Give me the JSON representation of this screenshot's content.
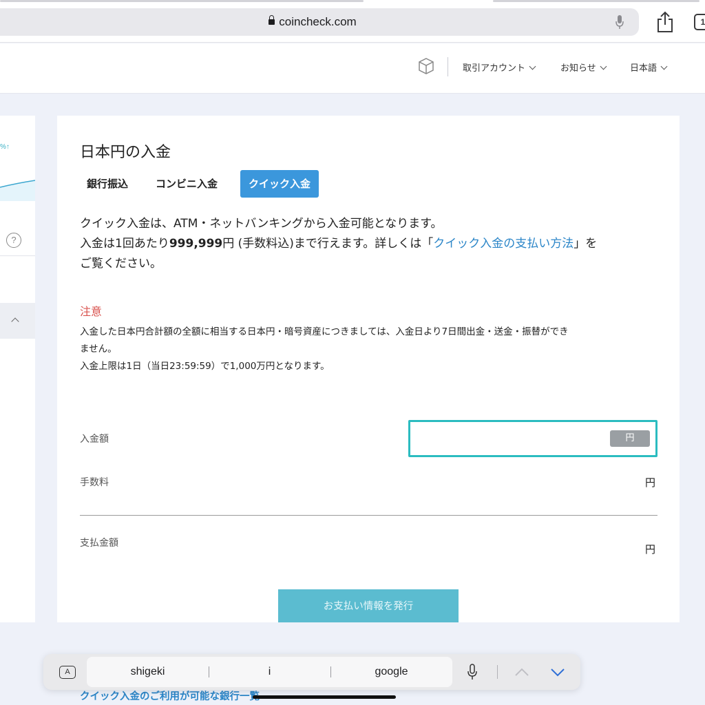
{
  "browser": {
    "url": "coincheck.com",
    "tabs_count": "1"
  },
  "header": {
    "nav": [
      {
        "label": "取引アカウント"
      },
      {
        "label": "お知らせ"
      },
      {
        "label": "日本語"
      }
    ]
  },
  "left_panel": {
    "percent_text": "%↑",
    "help_symbol": "?"
  },
  "card": {
    "title": "日本円の入金",
    "tabs": [
      {
        "label": "銀行振込",
        "active": false
      },
      {
        "label": "コンビニ入金",
        "active": false
      },
      {
        "label": "クイック入金",
        "active": true
      }
    ],
    "description": {
      "line1": "クイック入金は、ATM・ネットバンキングから入金可能となります。",
      "line2_prefix": "入金は1回あたり",
      "line2_amount": "999,999",
      "line2_middle": "円 (手数料込)まで行えます。詳しくは「",
      "line2_link": "クイック入金の支払い方法",
      "line2_suffix": "」を",
      "line3": "ご覧ください。"
    },
    "notice": {
      "title": "注意",
      "body1": "入金した日本円合計額の全額に相当する日本円・暗号資産につきましては、入金日より7日間出金・送金・振替ができ",
      "body2": "ません。",
      "body3": "入金上限は1日（当日23:59:59）で1,000万円となります。"
    },
    "form": {
      "amount_label": "入金額",
      "amount_value": "",
      "amount_unit": "円",
      "fee_label": "手数料",
      "fee_unit": "円",
      "total_label": "支払金額",
      "total_unit": "円"
    },
    "issue_button": "お支払い情報を発行"
  },
  "bottom_link": "クイック入金のご利用が可能な銀行一覧",
  "keyboard_bar": {
    "a_key": "A",
    "suggestions": [
      "shigeki",
      "i",
      "google"
    ]
  },
  "colors": {
    "accent_tab": "#3b97dc",
    "input_border": "#2bbcc0",
    "issue_button": "#5bbcd0",
    "notice": "#d9534f",
    "link": "#2c86c8"
  }
}
